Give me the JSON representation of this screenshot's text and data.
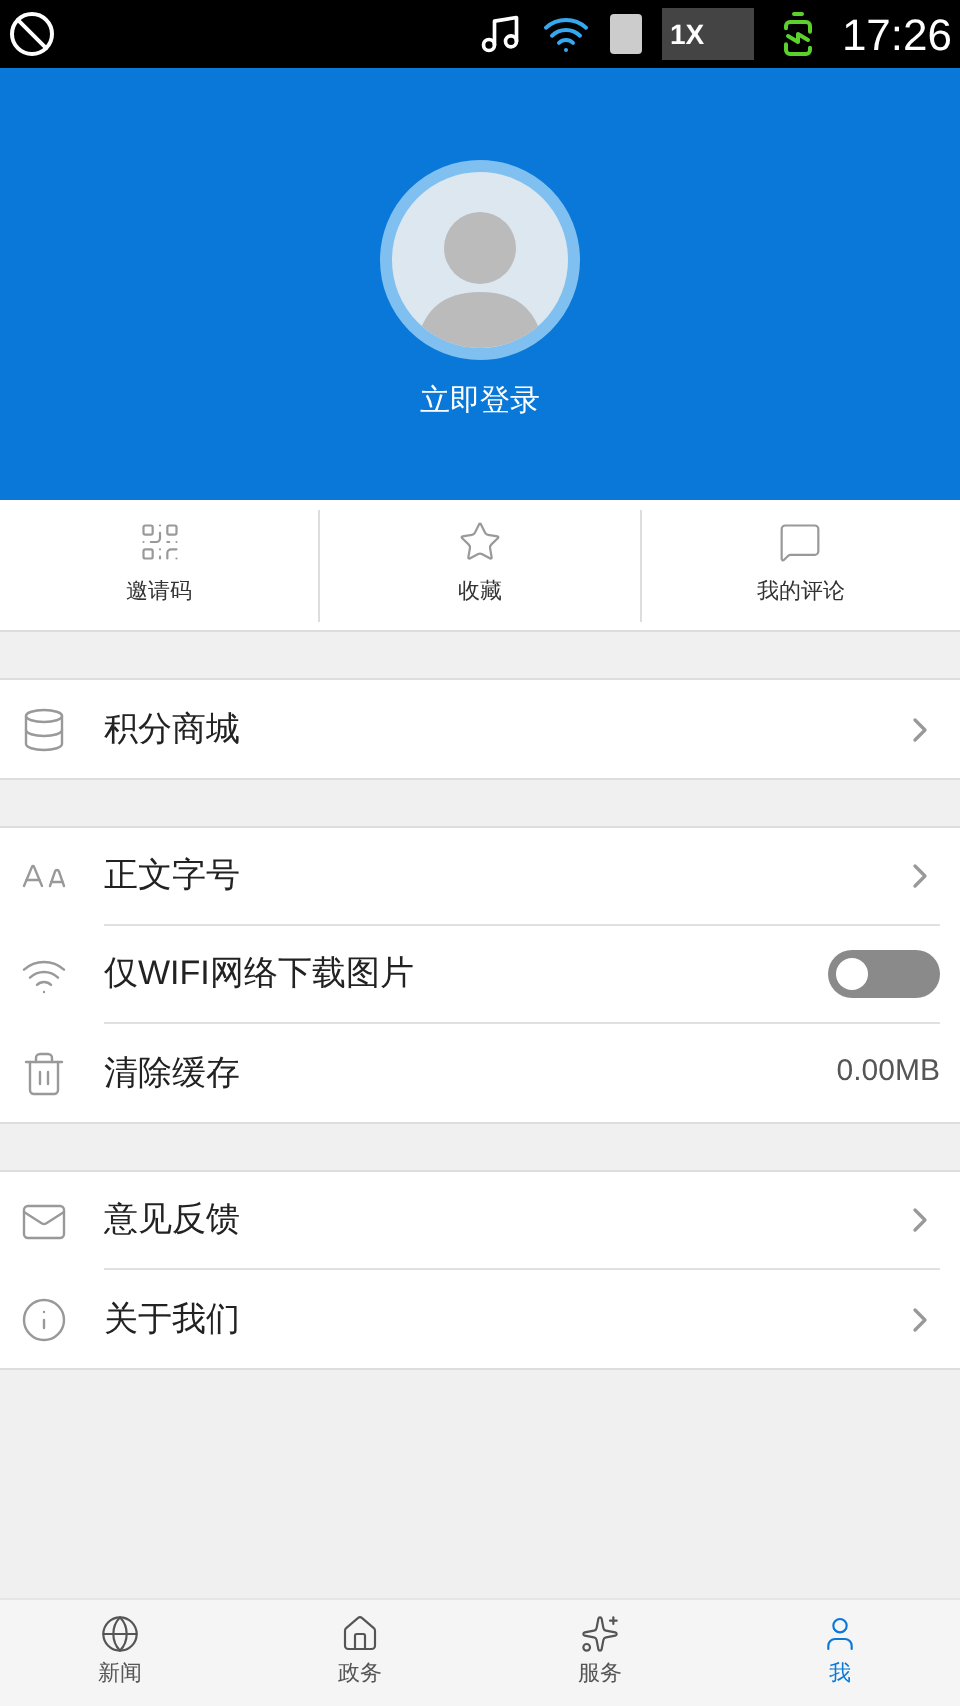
{
  "status_bar": {
    "network": "1X",
    "time": "17:26"
  },
  "profile": {
    "login_label": "立即登录"
  },
  "quick_actions": [
    {
      "label": "邀请码"
    },
    {
      "label": "收藏"
    },
    {
      "label": "我的评论"
    }
  ],
  "sections": [
    [
      {
        "kind": "link",
        "label": "积分商城"
      }
    ],
    [
      {
        "kind": "link",
        "label": "正文字号"
      },
      {
        "kind": "toggle",
        "label": "仅WIFI网络下载图片",
        "on": false
      },
      {
        "kind": "value",
        "label": "清除缓存",
        "value": "0.00MB"
      }
    ],
    [
      {
        "kind": "link",
        "label": "意见反馈"
      },
      {
        "kind": "link",
        "label": "关于我们"
      }
    ]
  ],
  "bottom_nav": [
    {
      "label": "新闻",
      "selected": false
    },
    {
      "label": "政务",
      "selected": false
    },
    {
      "label": "服务",
      "selected": false
    },
    {
      "label": "我",
      "selected": true
    }
  ]
}
